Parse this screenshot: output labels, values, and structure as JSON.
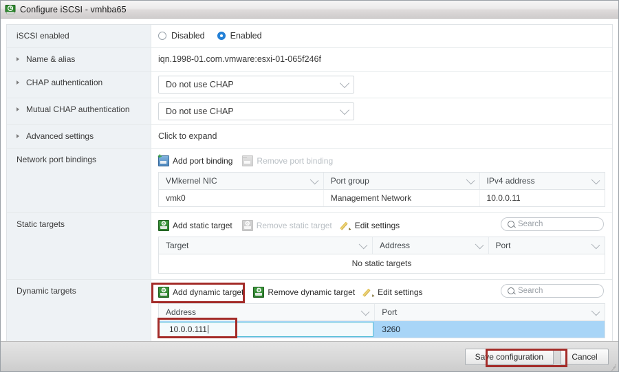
{
  "window": {
    "title": "Configure iSCSI - vmhba65",
    "icon": "iscsi-adapter-icon"
  },
  "form": {
    "iscsi_enabled": {
      "label": "iSCSI enabled",
      "options": [
        "Disabled",
        "Enabled"
      ],
      "selected": "Enabled"
    },
    "name_alias": {
      "label": "Name & alias",
      "value": "iqn.1998-01.com.vmware:esxi-01-065f246f"
    },
    "chap": {
      "label": "CHAP authentication",
      "value": "Do not use CHAP"
    },
    "mutual_chap": {
      "label": "Mutual CHAP authentication",
      "value": "Do not use CHAP"
    },
    "advanced": {
      "label": "Advanced settings",
      "value": "Click to expand"
    },
    "port_bindings": {
      "label": "Network port bindings",
      "actions": {
        "add": "Add port binding",
        "remove": "Remove port binding"
      },
      "columns": [
        "VMkernel NIC",
        "Port group",
        "IPv4 address"
      ],
      "rows": [
        [
          "vmk0",
          "Management Network",
          "10.0.0.11"
        ]
      ]
    },
    "static_targets": {
      "label": "Static targets",
      "actions": {
        "add": "Add static target",
        "remove": "Remove static target",
        "edit": "Edit settings"
      },
      "search_placeholder": "Search",
      "columns": [
        "Target",
        "Address",
        "Port"
      ],
      "rows": [],
      "empty_text": "No static targets"
    },
    "dynamic_targets": {
      "label": "Dynamic targets",
      "actions": {
        "add": "Add dynamic target",
        "remove": "Remove dynamic target",
        "edit": "Edit settings"
      },
      "search_placeholder": "Search",
      "columns": [
        "Address",
        "Port"
      ],
      "rows": [
        {
          "address": "10.0.0.111",
          "port": "3260",
          "editing": true,
          "selected": true
        }
      ]
    }
  },
  "footer": {
    "save_label": "Save configuration",
    "cancel_label": "Cancel"
  },
  "annotations": {
    "color": "#a32b28",
    "boxes": [
      "add-dynamic-target",
      "dynamic-address-input",
      "save-configuration"
    ]
  }
}
